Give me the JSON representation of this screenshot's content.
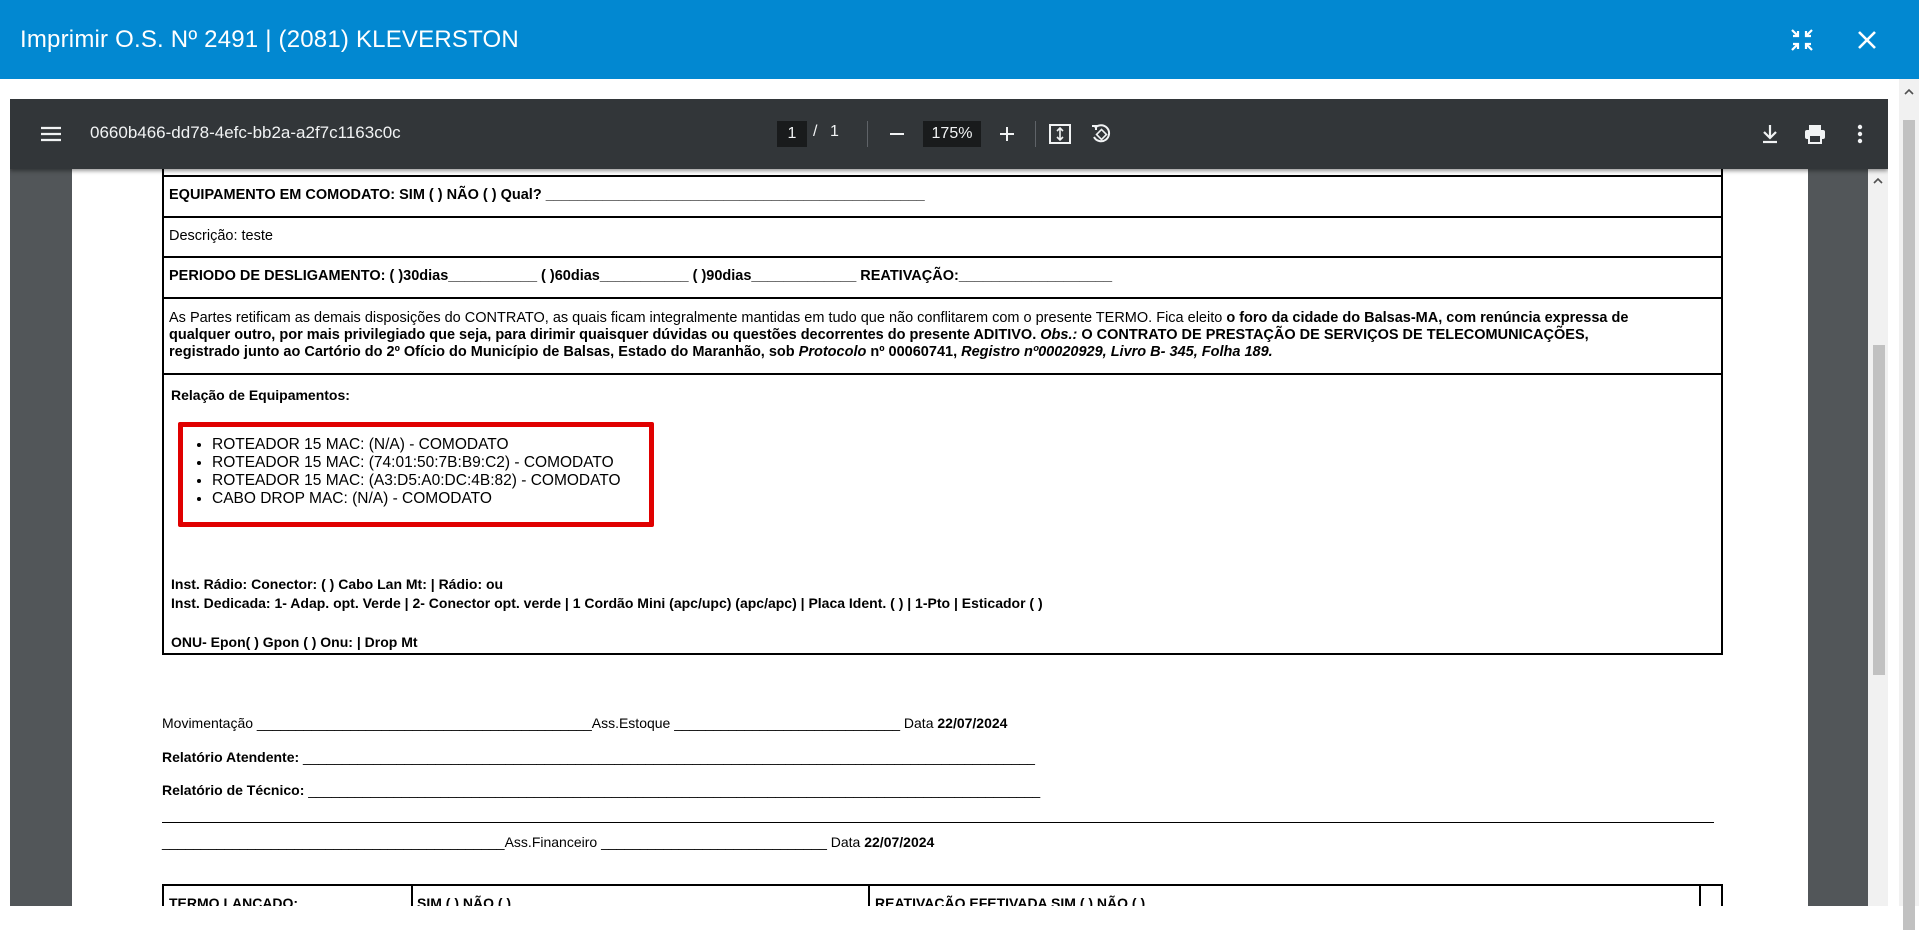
{
  "modal": {
    "title": "Imprimir O.S. Nº 2491 | (2081) KLEVERSTON",
    "minimize_icon": "collapse-arrows-icon",
    "close_icon": "close-icon"
  },
  "toolbar": {
    "menu_icon": "hamburger-menu-icon",
    "document_name": "0660b466-dd78-4efc-bb2a-a2f7c1163c0c",
    "current_page": "1",
    "page_separator": "/",
    "total_pages": "1",
    "zoom_out_icon": "minus-icon",
    "zoom_value": "175%",
    "zoom_in_icon": "plus-icon",
    "fit_icon": "fit-to-page-icon",
    "rotate_icon": "rotate-icon",
    "download_icon": "download-icon",
    "print_icon": "print-icon",
    "more_icon": "more-vertical-icon"
  },
  "document": {
    "comodato": "EQUIPAMENTO EM COMODATO: SIM ( ) NÃO ( ) Qual? _______________________________________________",
    "descricao": "Descrição: teste",
    "periodo": "PERIODO DE DESLIGAMENTO: (   )30dias___________  (   )60dias___________  (   )90dias_____________  REATIVAÇÃO:___________________",
    "partes_line1_a": "As Partes retificam as demais disposições do CONTRATO, as quais ficam integralmente mantidas em tudo que não conflitarem com o presente TERMO. Fica eleito ",
    "partes_line1_b": "o foro da cidade do Balsas-MA, com renúncia expressa de",
    "partes_line2_a": "qualquer outro, por mais privilegiado que seja, para dirimir  quaisquer dúvidas ou questões decorrentes do presente ADITIVO. ",
    "partes_line2_b": "Obs.:",
    "partes_line2_c": " O CONTRATO DE PRESTAÇÃO DE SERVIÇOS DE TELECOMUNICAÇÕES,",
    "partes_line3_a": "registrado junto ao Cartório do 2º Ofício do Município de Balsas, Estado do Maranhão, sob ",
    "partes_line3_b": "Protocolo",
    "partes_line3_c": " nº 00060741, ",
    "partes_line3_d": "Registro nº00020929, Livro B- 345, Folha 189.",
    "relacao_title": "Relação de Equipamentos:",
    "equipamentos": [
      "ROTEADOR 15 MAC: (N/A) - COMODATO",
      "ROTEADOR 15 MAC: (74:01:50:7B:B9:C2) - COMODATO",
      "ROTEADOR 15 MAC: (A3:D5:A0:DC:4B:82) - COMODATO",
      "CABO DROP MAC: (N/A) - COMODATO"
    ],
    "inst_radio": "Inst. Rádio: Conector: ( ) Cabo Lan Mt: | Rádio: ou",
    "inst_dedicada": "Inst. Dedicada: 1- Adap. opt. Verde | 2- Conector opt. verde | 1 Cordão Mini (apc/upc) (apc/apc) | Placa Ident. (    ) | 1-Pto | Esticador (  )",
    "onu": "ONU- Epon(     ) Gpon (     )  Onu: | Drop Mt",
    "movimentacao": "Movimentação ___________________________________________Ass.Estoque _____________________________ Data ",
    "movimentacao_date": "22/07/2024",
    "relatorio_atendente_label": "Relatório Atendente:",
    "relatorio_atendente_line": " ______________________________________________________________________________________________",
    "relatorio_tecnico_label": "Relatório de Técnico:",
    "relatorio_tecnico_line": " ______________________________________________________________________________________________",
    "financeiro": "____________________________________________Ass.Financeiro _____________________________ Data ",
    "financeiro_date": "22/07/2024",
    "termo_lancado": "TERMO LANÇADO:",
    "sim_nao": "SIM (    ) NÃO (    )",
    "reativacao_efetivada": "REATIVAÇÃO EFETIVADA SIM (    ) NÃO (    )"
  }
}
